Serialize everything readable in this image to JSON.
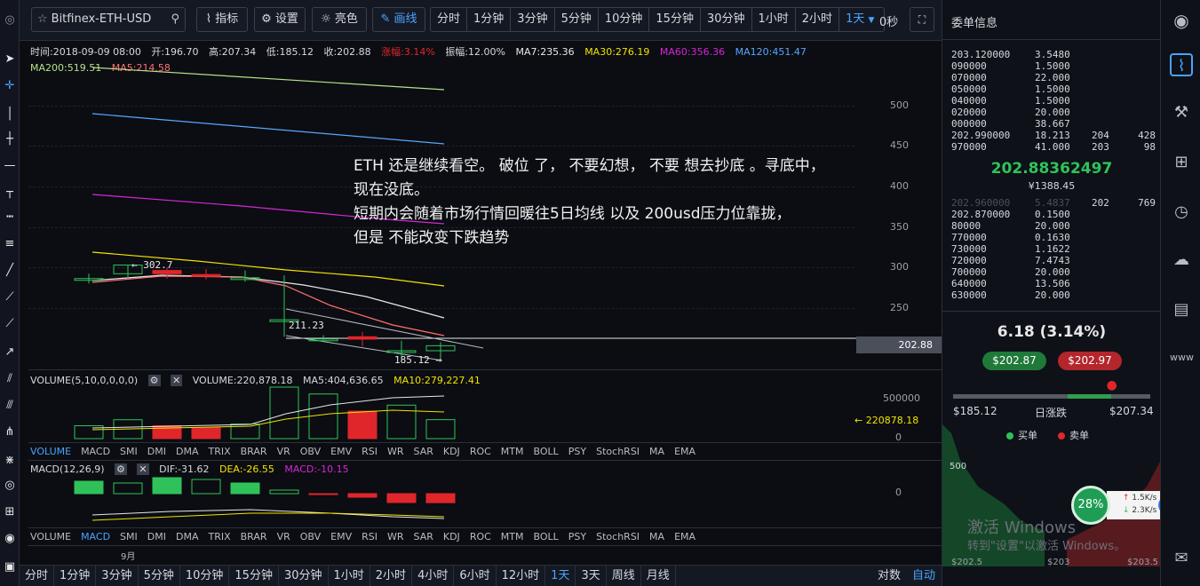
{
  "toolbar": {
    "symbol": "Bitfinex-ETH-USD",
    "indicators": "指标",
    "settings": "设置",
    "theme": "亮色",
    "drawing": "画线",
    "periods": [
      "分时",
      "1分钟",
      "3分钟",
      "5分钟",
      "10分钟",
      "15分钟",
      "30分钟",
      "1小时",
      "2小时",
      "1天"
    ],
    "active_period": "1天",
    "countdown": "0秒"
  },
  "info": {
    "time": "时间:2018-09-09 08:00",
    "open": "开:196.70",
    "high": "高:207.34",
    "low": "低:185.12",
    "close": "收:202.88",
    "change_pct": "涨幅:3.14%",
    "amplitude": "振幅:12.00%",
    "ma7": "MA7:235.36",
    "ma30": "MA30:276.19",
    "ma60": "MA60:356.36",
    "ma120": "MA120:451.47",
    "ma200": "MA200:519.51",
    "ma5": "MA5:214.58"
  },
  "colors": {
    "up": "#30c25a",
    "down": "#e0262b",
    "ma7": "#e8e8e8",
    "ma30": "#f2e200",
    "ma60": "#d626d6",
    "ma120": "#5aa6ff",
    "ma200": "#b8e08a",
    "ma5": "#ff7070",
    "accent": "#4aa3ff"
  },
  "price_axis": [
    "500",
    "450",
    "400",
    "350",
    "300",
    "250"
  ],
  "current_price_label": "202.88",
  "chart_labels": {
    "high_marker": "← 302.7",
    "mid_marker": "211.23",
    "low_marker": "185.12 →"
  },
  "annotation": [
    "ETH 还是继续看空。 破位 了， 不要幻想， 不要 想去抄底 。寻底中，",
    "现在没底。",
    "短期内会随着市场行情回暖往5日均线 以及 200usd压力位靠拢，",
    "但是 不能改变下跌趋势"
  ],
  "volume": {
    "title": "VOLUME(5,10,0,0,0,0)",
    "value": "VOLUME:220,878.18",
    "ma5": "MA5:404,636.65",
    "ma10": "MA10:279,227.41",
    "axis_top": "500000",
    "axis_zero": "0",
    "current": "← 220878.18"
  },
  "indicator_tabs": [
    "VOLUME",
    "MACD",
    "SMI",
    "DMI",
    "DMA",
    "TRIX",
    "BRAR",
    "VR",
    "OBV",
    "EMV",
    "RSI",
    "WR",
    "SAR",
    "KDJ",
    "ROC",
    "MTM",
    "BOLL",
    "PSY",
    "StochRSI",
    "MA",
    "EMA"
  ],
  "macd": {
    "title": "MACD(12,26,9)",
    "dif": "DIF:-31.62",
    "dea": "DEA:-26.55",
    "macd": "MACD:-10.15",
    "axis_zero": "0"
  },
  "month_label": "9月",
  "bottom": {
    "periods": [
      "分时",
      "1分钟",
      "3分钟",
      "5分钟",
      "10分钟",
      "15分钟",
      "30分钟",
      "1小时",
      "2小时",
      "4小时",
      "6小时",
      "12小时",
      "1天",
      "3天",
      "周线",
      "月线"
    ],
    "active": "1天",
    "log": "对数",
    "auto": "自动"
  },
  "orderbook": {
    "title": "委单信息",
    "asks": [
      {
        "price": "203.12",
        "rest": "0000",
        "amount": "3.5480"
      },
      {
        "price": "",
        "rest": "090000",
        "amount": "1.5000"
      },
      {
        "price": "",
        "rest": "070000",
        "amount": "22.000"
      },
      {
        "price": "",
        "rest": "050000",
        "amount": "1.5000"
      },
      {
        "price": "",
        "rest": "040000",
        "amount": "1.5000"
      },
      {
        "price": "",
        "rest": "020000",
        "amount": "20.000"
      },
      {
        "price": "",
        "rest": "000000",
        "amount": "38.667"
      },
      {
        "price": "202.99",
        "rest": "0000",
        "amount": "18.213",
        "c3": "204",
        "c4": "428"
      },
      {
        "price": "",
        "rest": "970000",
        "amount": "41.000",
        "c3": "203",
        "c4": "98"
      }
    ],
    "last_price": "202.88362497",
    "cny_price": "¥1388.45",
    "bids": [
      {
        "price": "202.96",
        "rest": "0000",
        "amount": "5.4837",
        "c3": "202",
        "c4": "769",
        "dim": true
      },
      {
        "price": "202.87",
        "rest": "0000",
        "amount": "0.1500"
      },
      {
        "price": "",
        "rest": "80000",
        "amount": "20.000"
      },
      {
        "price": "",
        "rest": "770000",
        "amount": "0.1630"
      },
      {
        "price": "",
        "rest": "730000",
        "amount": "1.1622"
      },
      {
        "price": "",
        "rest": "720000",
        "amount": "7.4743"
      },
      {
        "price": "",
        "rest": "700000",
        "amount": "20.000"
      },
      {
        "price": "",
        "rest": "640000",
        "amount": "13.506"
      },
      {
        "price": "",
        "rest": "630000",
        "amount": "20.000"
      }
    ]
  },
  "ticker": {
    "change": "6.18 (3.14%)",
    "bid": "$202.87",
    "ask": "$202.97",
    "day_low": "$185.12",
    "day_high": "$207.34",
    "range_label": "日涨跌",
    "range_position": 0.8,
    "buy_label": "买单",
    "sell_label": "卖单",
    "depth_axis": "500",
    "depth_x": [
      "$202.5",
      "$203",
      "$203.5"
    ]
  },
  "speed_widget": {
    "percent": "28%",
    "up": "1.5K/s",
    "down": "2.3K/s"
  },
  "watermark": {
    "line1": "激活 Windows",
    "line2": "转到\"设置\"以激活 Windows。"
  },
  "chart_data": {
    "type": "candlestick",
    "title": "",
    "dates": [
      "",
      "",
      "",
      "",
      "",
      "",
      "",
      "",
      "",
      "2018-09-09"
    ],
    "open": [
      284,
      292,
      296,
      291,
      287,
      235,
      211,
      214,
      196,
      196.7
    ],
    "close": [
      286,
      302.7,
      292,
      290,
      287,
      235,
      211.23,
      211,
      196.7,
      202.88
    ],
    "low": [
      280,
      286,
      286,
      285,
      282,
      214,
      210,
      202,
      185.12,
      185.12
    ],
    "high": [
      292,
      302.7,
      300,
      298,
      296,
      290,
      216,
      220,
      209,
      207.34
    ],
    "volume": [
      150000,
      220000,
      150000,
      130000,
      170000,
      600000,
      520000,
      320000,
      390000,
      220878.18
    ],
    "macd_hist": [
      14,
      12,
      18,
      16,
      12,
      4,
      -1,
      -4,
      -10,
      -10.15
    ],
    "ylim": [
      185,
      520
    ]
  }
}
